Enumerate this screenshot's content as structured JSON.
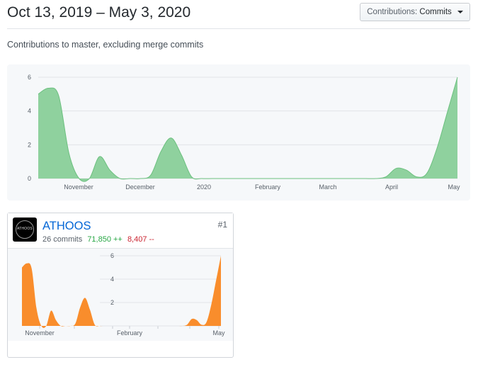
{
  "header": {
    "date_range": "Oct 13, 2019 – May 3, 2020",
    "contributions_button": {
      "label": "Contributions:",
      "value": "Commits"
    }
  },
  "subtitle": "Contributions to master, excluding merge commits",
  "colors": {
    "main_area": "#8fd19e",
    "main_line": "#6cc07f",
    "contributor_area": "#f98d2c",
    "grid": "#e1e4e8"
  },
  "contributor": {
    "rank": "#1",
    "name": "ATHOOS",
    "avatar_text": "ATHOOS",
    "commits": "26 commits",
    "additions": "71,850 ++",
    "deletions": "8,407 --"
  },
  "chart_data": [
    {
      "type": "area",
      "x_ticks": [
        "November",
        "December",
        "2020",
        "February",
        "March",
        "April",
        "May"
      ],
      "y_ticks": [
        "0",
        "2",
        "4",
        "6"
      ],
      "ylim": [
        0,
        6
      ],
      "grid": true,
      "values": [
        5.0,
        5.35,
        4.9,
        1.5,
        0,
        0,
        1.3,
        0.5,
        0,
        0,
        0,
        0.2,
        1.6,
        2.4,
        1.4,
        0.1,
        0,
        0,
        0,
        0,
        0,
        0,
        0,
        0,
        0,
        0,
        0,
        0,
        0,
        0,
        0,
        0,
        0,
        0,
        0.1,
        0.6,
        0.5,
        0.1,
        0.3,
        1.8,
        3.9,
        6.0
      ]
    },
    {
      "type": "area",
      "x_ticks": [
        "November",
        "February",
        "May"
      ],
      "y_ticks": [
        "2",
        "4",
        "6"
      ],
      "ylim": [
        0,
        6
      ],
      "grid": true,
      "values": [
        5.0,
        5.35,
        4.9,
        1.5,
        0,
        0,
        1.3,
        0.5,
        0,
        0,
        0,
        0.2,
        1.6,
        2.4,
        1.4,
        0.1,
        0,
        0,
        0,
        0,
        0,
        0,
        0,
        0,
        0,
        0,
        0,
        0,
        0,
        0,
        0,
        0,
        0,
        0,
        0.1,
        0.6,
        0.5,
        0.1,
        0.3,
        1.8,
        3.9,
        6.0
      ]
    }
  ]
}
